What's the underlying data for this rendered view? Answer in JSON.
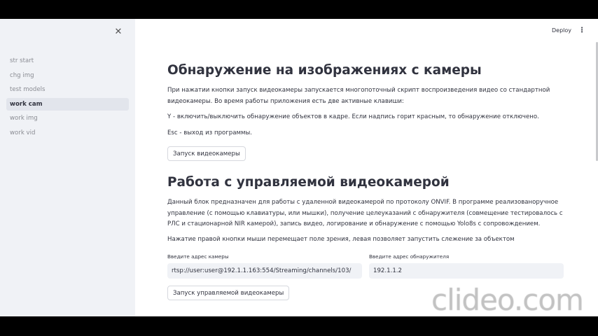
{
  "sidebar": {
    "close_icon": "close-icon",
    "items": [
      {
        "label": "str start",
        "active": false
      },
      {
        "label": "chg img",
        "active": false
      },
      {
        "label": "test models",
        "active": false
      },
      {
        "label": "work cam",
        "active": true
      },
      {
        "label": "work img",
        "active": false
      },
      {
        "label": "work vid",
        "active": false
      }
    ]
  },
  "header": {
    "deploy_label": "Deploy",
    "menu_icon": "more-vertical-icon"
  },
  "section1": {
    "title": "Обнаружение на изображениях с камеры",
    "para1": "При нажатии кнопки запуск видеокамеры запускается многопоточный скрипт воспроизведения видео со стандартной видеокамеры. Во время работы приложения есть две активные клавиши:",
    "para2": "Y - включить/выключить обнаружение объектов в кадре. Если надпись горит красным, то обнаружение отключено.",
    "para3": "Esc - выход из программы.",
    "button": "Запуск видеокамеры"
  },
  "section2": {
    "title": "Работа с управляемой видеокамерой",
    "para1": "Данный блок предназначен для работы с удаленной видеокамерой по протоколу ONVIF. В программе реализованоручное управление (с помощью клавиатуры, или мышки), получение целеуказаний с обнаружителя (совмещение тестировалось с РЛС и стационарной NIR камерой), запись видео, логирование и обнаружение с помощью Yolo8s с сопровождением.",
    "para2": "Нажатие правой кнопки мыши перемещает поле зрения, левая позволяет запустить слежение за объектом",
    "camera_label": "Введите адрес камеры",
    "camera_value": "rtsp://user:user@192.1.1.163:554/Streaming/channels/103/",
    "detector_label": "Введите адрес обнаружителя",
    "detector_value": "192.1.1.2",
    "button": "Запуск управляемой видеокамеры"
  },
  "watermark": "clideo.com"
}
